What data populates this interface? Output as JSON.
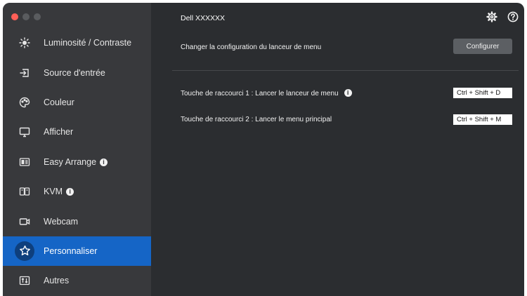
{
  "app": {
    "monitor_name": "Dell XXXXXX"
  },
  "window_controls": {
    "close_color": "#ff5f57",
    "minimize_color": "#5a5c5f",
    "zoom_color": "#5a5c5f"
  },
  "sidebar": {
    "items": [
      {
        "label": "Luminosité / Contraste",
        "icon": "brightness-icon"
      },
      {
        "label": "Source d'entrée",
        "icon": "input-source-icon"
      },
      {
        "label": "Couleur",
        "icon": "color-palette-icon"
      },
      {
        "label": "Afficher",
        "icon": "monitor-icon"
      },
      {
        "label": "Easy Arrange",
        "icon": "easy-arrange-icon",
        "info": true
      },
      {
        "label": "KVM",
        "icon": "kvm-icon",
        "info": true
      },
      {
        "label": "Webcam",
        "icon": "webcam-icon"
      },
      {
        "label": "Personnaliser",
        "icon": "star-icon",
        "active": true
      },
      {
        "label": "Autres",
        "icon": "others-icon"
      }
    ],
    "info_glyph": "i",
    "active_color": "#1565c6"
  },
  "main": {
    "launcher_label": "Changer la configuration du lanceur de menu",
    "configure_button": "Configurer",
    "shortcut1_label": "Touche de raccourci 1 : Lancer le lanceur de menu",
    "shortcut1_value": "Ctrl + Shift + D",
    "shortcut2_label": "Touche de raccourci 2 : Lancer le menu principal",
    "shortcut2_value": "Ctrl + Shift + M"
  },
  "header_icons": {
    "settings": "gear-icon",
    "help": "help-icon"
  }
}
